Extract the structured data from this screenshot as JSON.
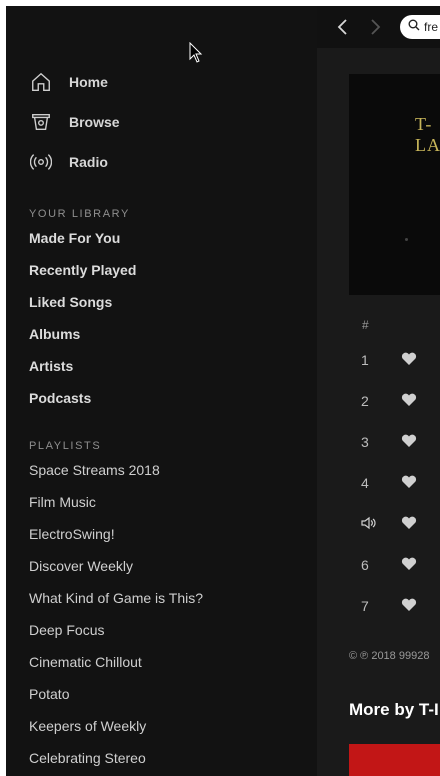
{
  "sidebar": {
    "nav": [
      {
        "label": "Home",
        "icon": "home-icon"
      },
      {
        "label": "Browse",
        "icon": "browse-icon"
      },
      {
        "label": "Radio",
        "icon": "radio-icon"
      }
    ],
    "library_title": "YOUR LIBRARY",
    "library": [
      "Made For You",
      "Recently Played",
      "Liked Songs",
      "Albums",
      "Artists",
      "Podcasts"
    ],
    "playlists_title": "PLAYLISTS",
    "playlists": [
      "Space Streams 2018",
      "Film Music",
      "ElectroSwing!",
      "Discover Weekly",
      "What Kind of Game is This?",
      "Deep Focus",
      "Cinematic Chillout",
      "Potato",
      "Keepers of Weekly",
      "Celebrating Stereo"
    ]
  },
  "main": {
    "search_value": "fre",
    "cover_text": "T-LA",
    "hash_label": "#",
    "tracks": [
      "1",
      "2",
      "3",
      "4",
      "",
      "6",
      "7"
    ],
    "copyright": "© ℗ 2018 99928",
    "more_by": "More by T-I"
  },
  "colors": {
    "accent": "#1db954",
    "bg": "#121212"
  }
}
